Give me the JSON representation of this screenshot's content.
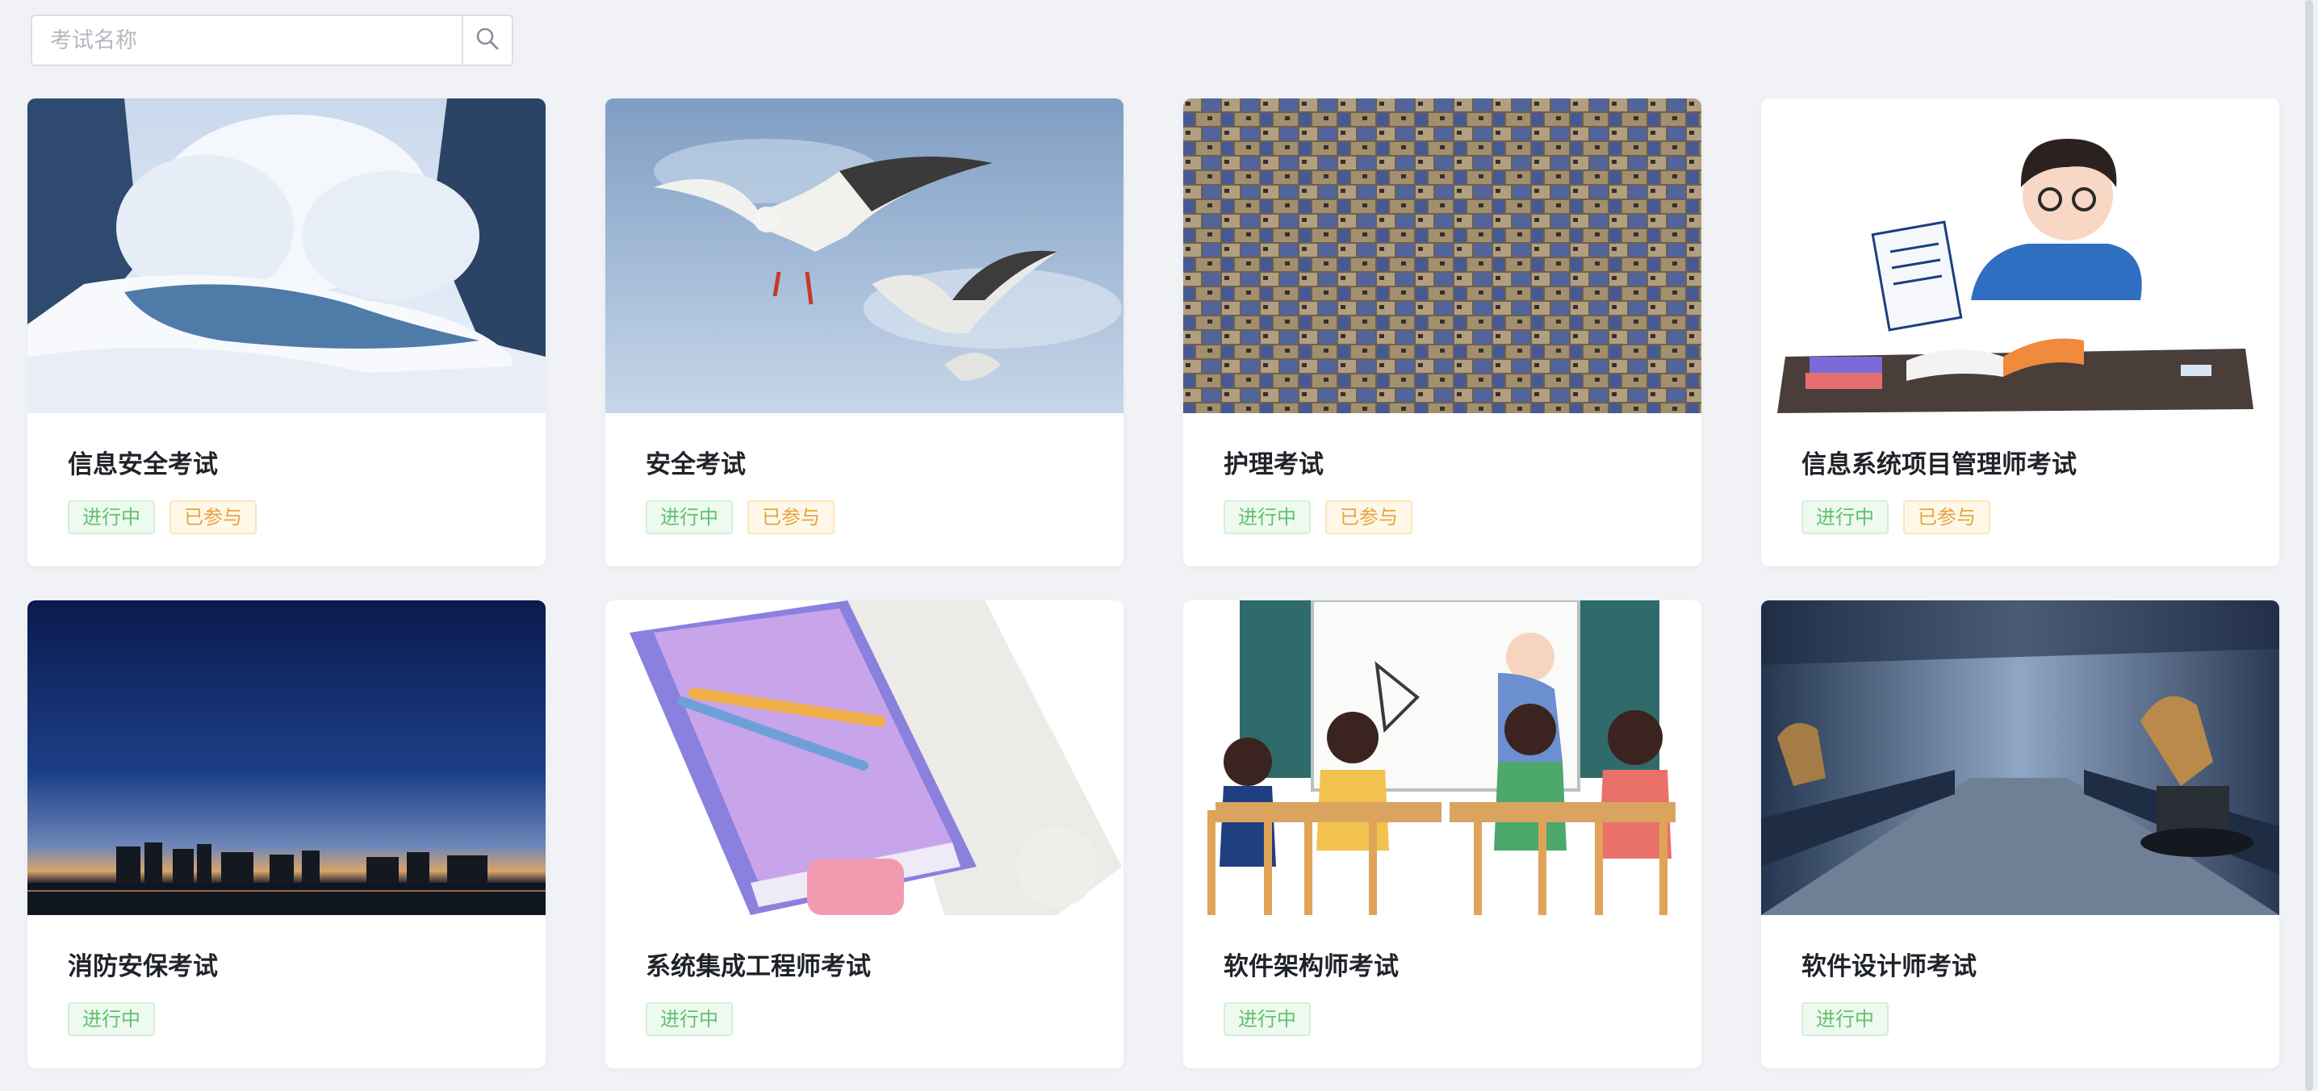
{
  "search": {
    "placeholder": "考试名称",
    "icon": "search-icon"
  },
  "exams": [
    {
      "title": "信息安全考试",
      "tags": [
        "进行中",
        "已参与"
      ],
      "image": "snowy-forest-river"
    },
    {
      "title": "安全考试",
      "tags": [
        "进行中",
        "已参与"
      ],
      "image": "flying-seagulls"
    },
    {
      "title": "护理考试",
      "tags": [
        "进行中",
        "已参与"
      ],
      "image": "blue-city-rooftops"
    },
    {
      "title": "信息系统项目管理师考试",
      "tags": [
        "进行中",
        "已参与"
      ],
      "image": "boy-studying-illustration"
    },
    {
      "title": "消防安保考试",
      "tags": [
        "进行中"
      ],
      "image": "night-city-skyline"
    },
    {
      "title": "系统集成工程师考试",
      "tags": [
        "进行中"
      ],
      "image": "book-and-pencils-illustration"
    },
    {
      "title": "软件架构师考试",
      "tags": [
        "进行中"
      ],
      "image": "classroom-illustration"
    },
    {
      "title": "软件设计师考试",
      "tags": [
        "进行中"
      ],
      "image": "robot-factory"
    }
  ],
  "colors": {
    "background": "#f0f2f5",
    "ongoing_tag": "#5ec36a",
    "joined_tag": "#e7a43b"
  }
}
